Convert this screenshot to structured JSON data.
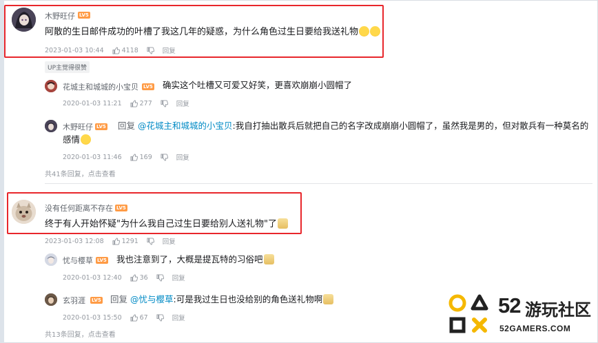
{
  "comments": [
    {
      "user": "木野旺仔",
      "level": "LV5",
      "content": "阿散的生日邮件成功的叶槽了我这几年的疑惑，为什么角色过生日要给我送礼物",
      "time": "2023-01-03 10:44",
      "likes": "4118",
      "reply_label": "回复",
      "up_tag": "UP主觉得很赞",
      "replies": [
        {
          "user": "花城主和城城的小宝贝",
          "level": "LV5",
          "content": "确实这个吐槽又可爱又好笑，更喜欢崩崩小圆帽了",
          "time": "2020-01-03 11:21",
          "likes": "277",
          "reply_label": "回复"
        },
        {
          "user": "木野旺仔",
          "level": "LV5",
          "prefix": "回复",
          "mention": "@花城主和城城的小宝贝",
          "content_line1": ":我自打抽出散兵后就把自己的名字改成崩崩小圆帽了，虽然我是男的，但对散兵有一种莫名的",
          "content_line2": "感情",
          "time": "2020-01-03 11:46",
          "likes": "169",
          "reply_label": "回复"
        }
      ],
      "view_more": "共41条回复，点击查看"
    },
    {
      "user": "没有任何距离不存在",
      "level": "LV5",
      "content": "终于有人开始怀疑\"为什么我自己过生日要给别人送礼物\"了",
      "time": "2023-01-03 12:08",
      "likes": "1291",
      "reply_label": "回复",
      "replies": [
        {
          "user": "忧与樱草",
          "level": "LV5",
          "content": "我也注意到了，大概是提瓦特的习俗吧",
          "time": "2020-01-03 12:40",
          "likes": "36",
          "reply_label": "回复"
        },
        {
          "user": "玄羽涯",
          "level": "LV5",
          "prefix": "回复",
          "mention": "@忧与樱草",
          "content": ":可是我过生日也没给别的角色送礼物啊",
          "time": "2020-01-03 15:50",
          "likes": "67",
          "reply_label": "回复"
        }
      ],
      "view_more": "共13条回复，点击查看"
    }
  ],
  "watermark": {
    "number": "52",
    "cn": "游玩社区",
    "domain": "52GAMERS.COM"
  },
  "colors": {
    "highlight": "#e8262b",
    "mention": "#008ac5",
    "level_badge": "#ff9b45",
    "logo_yellow": "#f5b800"
  }
}
